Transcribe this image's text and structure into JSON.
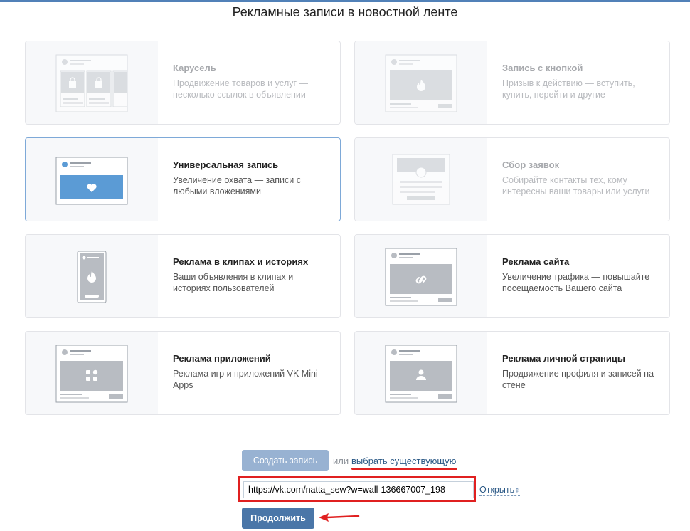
{
  "header": {
    "title": "Рекламные записи в новостной ленте"
  },
  "cards": [
    {
      "title": "Карусель",
      "desc": "Продвижение товаров и услуг — несколько ссылок в объявлении",
      "state": "disabled"
    },
    {
      "title": "Запись с кнопкой",
      "desc": "Призыв к действию — вступить, купить, перейти и другие",
      "state": "disabled"
    },
    {
      "title": "Универсальная запись",
      "desc": "Увеличение охвата — записи с любыми вложениями",
      "state": "selected"
    },
    {
      "title": "Сбор заявок",
      "desc": "Собирайте контакты тех, кому интересны ваши товары или услуги",
      "state": "disabled"
    },
    {
      "title": "Реклама в клипах и историях",
      "desc": "Ваши объявления в клипах и историях пользователей",
      "state": "normal"
    },
    {
      "title": "Реклама сайта",
      "desc": "Увеличение трафика — повышайте посещаемость Вашего сайта",
      "state": "normal"
    },
    {
      "title": "Реклама приложений",
      "desc": "Реклама игр и приложений VK Mini Apps",
      "state": "normal"
    },
    {
      "title": "Реклама личной страницы",
      "desc": "Продвижение профиля и записей на стене",
      "state": "normal"
    }
  ],
  "actions": {
    "create_label": "Создать запись",
    "or_text": "или",
    "choose_existing_label": "выбрать существующую",
    "url_value": "https://vk.com/natta_sew?w=wall-136667007_198",
    "open_label": "Открыть",
    "open_arrow": "⇞",
    "continue_label": "Продолжить"
  },
  "colors": {
    "accent": "#4a76a8",
    "button_disabled": "#98b2d2",
    "selection_highlight": "#5b9bd5",
    "annotation_red": "#e02020"
  },
  "icons": [
    "shopping-bag-icon",
    "fire-icon",
    "heart-icon",
    "circle-icon",
    "link-icon",
    "apps-grid-icon",
    "user-icon",
    "arrow-icon"
  ]
}
